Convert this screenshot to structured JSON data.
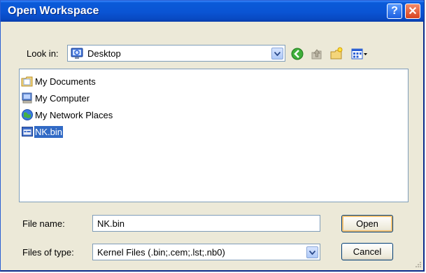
{
  "window": {
    "title": "Open Workspace"
  },
  "titlebar": {
    "help_label": "?",
    "close_label": "✕"
  },
  "lookin": {
    "label": "Look in:",
    "value": "Desktop",
    "icon": "desktop-icon"
  },
  "toolbar": {
    "icons": [
      "back-icon",
      "up-folder-icon",
      "new-folder-icon",
      "view-menu-icon"
    ]
  },
  "filelist": {
    "items": [
      {
        "label": "My Documents",
        "icon": "my-documents-icon",
        "selected": false
      },
      {
        "label": "My Computer",
        "icon": "my-computer-icon",
        "selected": false
      },
      {
        "label": "My Network Places",
        "icon": "network-places-icon",
        "selected": false
      },
      {
        "label": "NK.bin",
        "icon": "bin-file-icon",
        "selected": true
      }
    ]
  },
  "filename": {
    "label": "File name:",
    "value": "NK.bin"
  },
  "filetype": {
    "label": "Files of type:",
    "value": "Kernel Files (.bin;.cem;.lst;.nb0)"
  },
  "buttons": {
    "open": "Open",
    "cancel": "Cancel"
  },
  "colors": {
    "titlebar": "#0a54d4",
    "selection": "#316ac5",
    "face": "#ece9d8"
  }
}
